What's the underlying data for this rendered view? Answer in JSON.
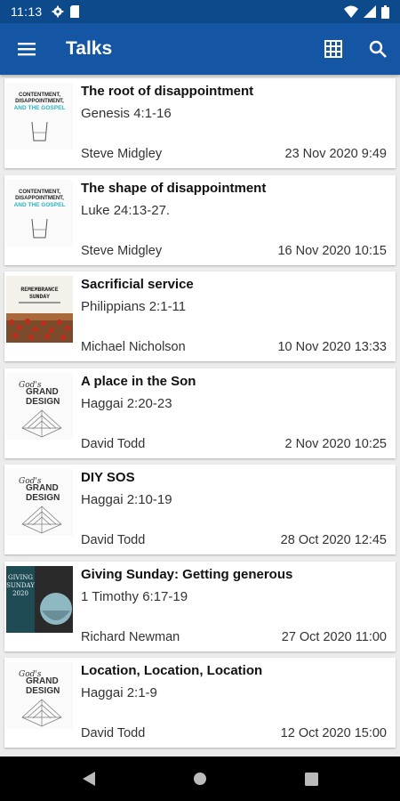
{
  "status_bar": {
    "time": "11:13"
  },
  "app_bar": {
    "title": "Talks"
  },
  "talks": [
    {
      "title": "The root of disappointment",
      "passage": "Genesis 4:1-16",
      "speaker": "Steve Midgley",
      "date": "23 Nov 2020 9:49",
      "art": "contentment"
    },
    {
      "title": "The shape of disappointment",
      "passage": "Luke 24:13-27.",
      "speaker": "Steve Midgley",
      "date": "16 Nov 2020 10:15",
      "art": "contentment"
    },
    {
      "title": "Sacrificial service",
      "passage": "Philippians 2:1-11",
      "speaker": "Michael Nicholson",
      "date": "10 Nov 2020 13:33",
      "art": "remembrance"
    },
    {
      "title": "A place in the Son",
      "passage": "Haggai 2:20-23",
      "speaker": "David Todd",
      "date": "2 Nov 2020 10:25",
      "art": "grand-design"
    },
    {
      "title": "DIY SOS",
      "passage": "Haggai 2:10-19",
      "speaker": "David Todd",
      "date": "28 Oct 2020 12:45",
      "art": "grand-design"
    },
    {
      "title": "Giving Sunday: Getting generous",
      "passage": "1 Timothy 6:17-19",
      "speaker": "Richard Newman",
      "date": "27 Oct 2020 11:00",
      "art": "giving"
    },
    {
      "title": "Location, Location, Location",
      "passage": "Haggai 2:1-9",
      "speaker": "David Todd",
      "date": "12 Oct 2020 15:00",
      "art": "grand-design"
    }
  ],
  "artwork_text": {
    "contentment_line1": "CONTENTMENT,",
    "contentment_line2": "DISAPPOINTMENT,",
    "contentment_line3": "AND THE GOSPEL",
    "remembrance_line1": "REMEMBRANCE",
    "remembrance_line2": "SUNDAY",
    "grand_script": "God's",
    "grand_line1": "GRAND",
    "grand_line2": "DESIGN",
    "giving_line1": "GIVING",
    "giving_line2": "SUNDAY",
    "giving_line3": "2020"
  },
  "colors": {
    "status_bar": "#0d4a8c",
    "app_bar": "#1456a3",
    "background": "#ececec",
    "contentment_accent": "#2bb3c0"
  }
}
